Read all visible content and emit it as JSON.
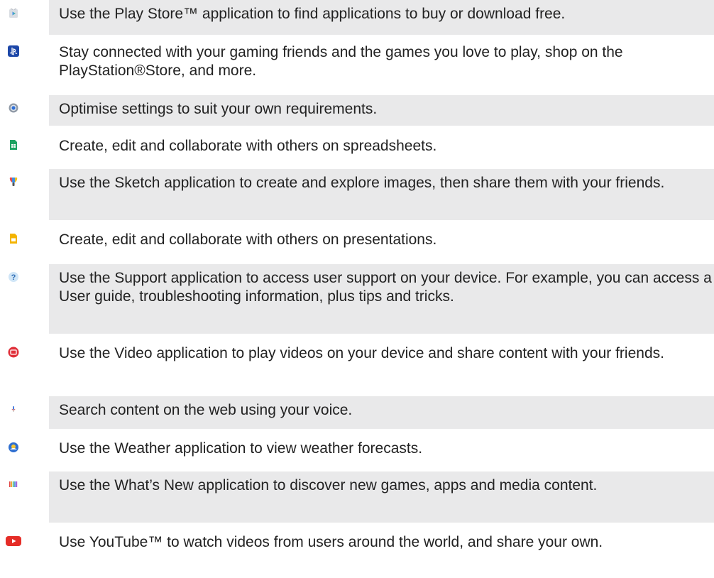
{
  "app_list": {
    "items": [
      {
        "icon": "play-store-icon",
        "text": "Use the Play Store™ application to find applications to buy or download free."
      },
      {
        "icon": "playstation-icon",
        "text": "Stay connected with your gaming friends and the games you love to play, shop on the PlayStation®Store, and more."
      },
      {
        "icon": "settings-gear-icon",
        "text": "Optimise settings to suit your own requirements."
      },
      {
        "icon": "sheets-icon",
        "text": "Create, edit and collaborate with others on spreadsheets."
      },
      {
        "icon": "sketch-icon",
        "text": "Use the Sketch application to create and explore images, then share them with your friends."
      },
      {
        "icon": "slides-icon",
        "text": "Create, edit and collaborate with others on presentations."
      },
      {
        "icon": "support-question-icon",
        "text": "Use the Support application to access user support on your device. For example, you can access a User guide, troubleshooting information, plus tips and tricks."
      },
      {
        "icon": "video-icon",
        "text": "Use the Video application to play videos on your device and share content with your friends."
      },
      {
        "icon": "voice-search-mic-icon",
        "text": "Search content on the web using your voice."
      },
      {
        "icon": "weather-icon",
        "text": "Use the Weather application to view weather forecasts."
      },
      {
        "icon": "whats-new-icon",
        "text": "Use the What’s New application to discover new games, apps and media content."
      },
      {
        "icon": "youtube-icon",
        "text": "Use YouTube™ to watch videos from users around the world, and share your own."
      }
    ]
  }
}
